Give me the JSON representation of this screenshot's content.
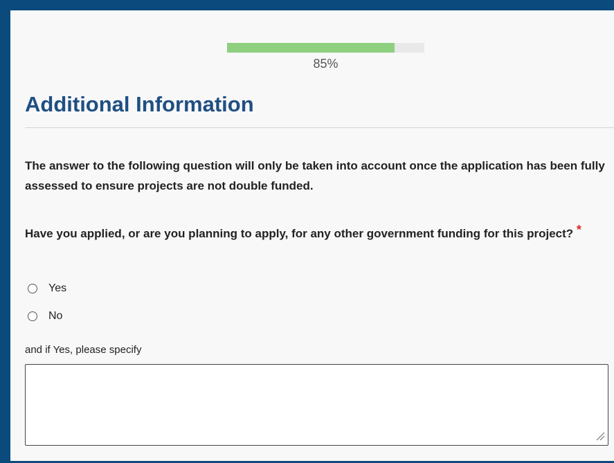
{
  "progress": {
    "percent_text": "85%",
    "value": 0.85
  },
  "page": {
    "title": "Additional Information",
    "intro": "The answer to the following question will only be taken into account once the application has been fully assessed to ensure projects are not double funded.",
    "question": "Have you applied, or are you planning to apply, for any other government funding for this project?",
    "required_marker": "*",
    "options": [
      {
        "label": "Yes"
      },
      {
        "label": "No"
      }
    ],
    "specify_label": "and if Yes, please specify",
    "specify_value": ""
  },
  "icons": {
    "required": "asterisk-icon",
    "resize": "resize-handle-icon"
  },
  "colors": {
    "outer_frame": "#0b4a7c",
    "title": "#1f4f83",
    "progress_fill": "#8fcf80",
    "progress_track": "#e9e9e9",
    "required": "#d92b2b"
  }
}
